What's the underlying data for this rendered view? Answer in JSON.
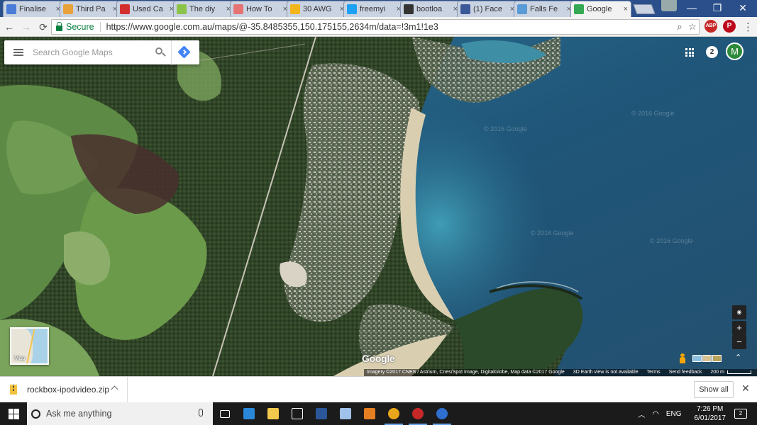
{
  "browser": {
    "tabs": [
      {
        "title": "Finalise",
        "favicon": "document-icon",
        "color": "#4a7bd6",
        "active": false
      },
      {
        "title": "Third Pa",
        "favicon": "aws-icon",
        "color": "#e9a23b",
        "active": false
      },
      {
        "title": "Used Ca",
        "favicon": "rb-icon",
        "color": "#d32f2f",
        "active": false
      },
      {
        "title": "The diy",
        "favicon": "note-icon",
        "color": "#8bc34a",
        "active": false
      },
      {
        "title": "How To",
        "favicon": "bookmark-icon",
        "color": "#e57373",
        "active": false
      },
      {
        "title": "30 AWG",
        "favicon": "shopping-icon",
        "color": "#f2b51b",
        "active": false
      },
      {
        "title": "freemyi",
        "favicon": "twitter-icon",
        "color": "#1da1f2",
        "active": false
      },
      {
        "title": "bootloa",
        "favicon": "github-icon",
        "color": "#333333",
        "active": false
      },
      {
        "title": "(1) Face",
        "favicon": "facebook-icon",
        "color": "#3b5998",
        "active": false
      },
      {
        "title": "Falls Fe",
        "favicon": "falls-icon",
        "color": "#5b9bd5",
        "active": false
      },
      {
        "title": "Google",
        "favicon": "google-maps-icon",
        "color": "#34a853",
        "active": true
      }
    ],
    "tab_close": "×",
    "window_buttons": {
      "minimize": "—",
      "restore": "❐",
      "close": "✕"
    },
    "nav": {
      "back": "←",
      "forward": "→",
      "reload": "⟳"
    },
    "secure_label": "Secure",
    "url": "https://www.google.com.au/maps/@-35.8485355,150.175155,2634m/data=!3m1!1e3",
    "extensions": [
      {
        "name": "adblock-icon",
        "label": "ABP",
        "color": "#c62828"
      },
      {
        "name": "pinterest-icon",
        "label": "P",
        "color": "#bd081c"
      }
    ],
    "menu": "⋮"
  },
  "maps": {
    "search_placeholder": "Search Google Maps",
    "notification_count": "2",
    "avatar_initial": "M",
    "minimap_label": "Map",
    "logo": "Google",
    "watermark": "© 2016 Google",
    "zoom_in": "+",
    "zoom_out": "−",
    "collapse": "⌃",
    "attribution": {
      "imagery": "Imagery ©2017 CNES / Astrium, Cnes/Spot Image, DigitalGlobe, Map data ©2017 Google",
      "earth": "3D Earth view is not available",
      "terms": "Terms",
      "feedback": "Send feedback",
      "scale": "200 m"
    }
  },
  "downloads": {
    "file_name": "rockbox-ipodvideo.zip",
    "show_all": "Show all",
    "close": "✕"
  },
  "taskbar": {
    "search_placeholder": "Ask me anything",
    "apps": [
      {
        "name": "task-view-icon",
        "color": "#ffffff",
        "active": false
      },
      {
        "name": "edge-icon",
        "color": "#2b88d8",
        "active": false
      },
      {
        "name": "file-explorer-icon",
        "color": "#f2c94c",
        "active": false
      },
      {
        "name": "store-icon",
        "color": "#ffffff",
        "active": false
      },
      {
        "name": "word-icon",
        "color": "#2b579a",
        "active": false
      },
      {
        "name": "phone-app-icon",
        "color": "#9fc1ea",
        "active": false
      },
      {
        "name": "monitor-app-icon",
        "color": "#e67e22",
        "active": false
      },
      {
        "name": "chrome-icon",
        "color": "#e8a61a",
        "active": true
      },
      {
        "name": "radio-app-icon",
        "color": "#c62828",
        "active": true
      },
      {
        "name": "media-app-icon",
        "color": "#2f6fd0",
        "active": true
      }
    ],
    "language": "ENG",
    "time": "7:26 PM",
    "date": "6/01/2017",
    "notifications": "2"
  }
}
